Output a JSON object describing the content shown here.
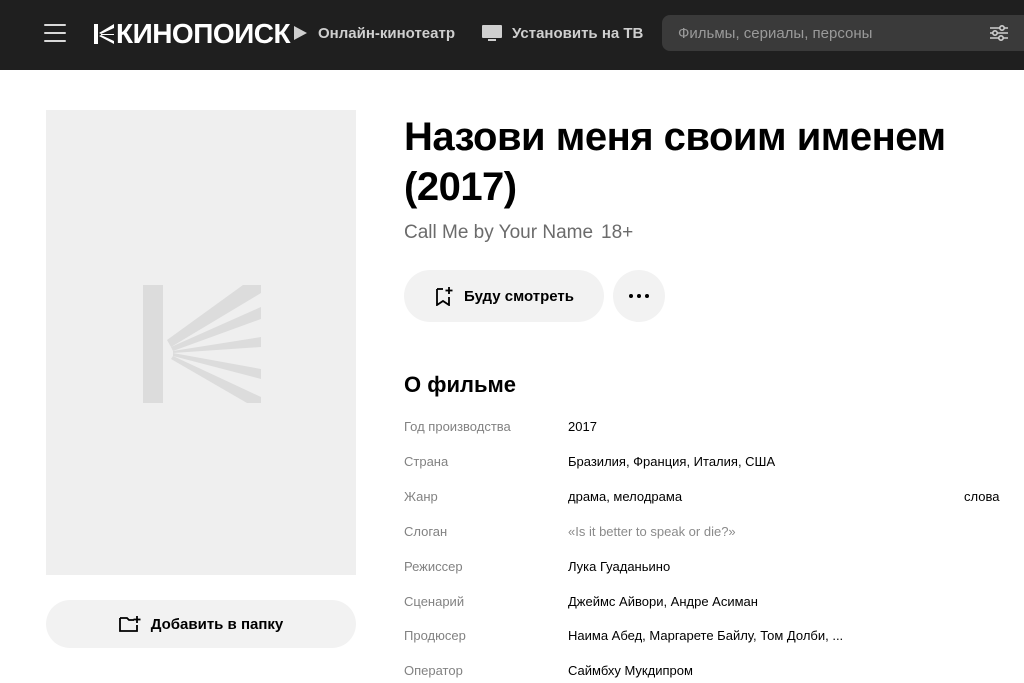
{
  "header": {
    "logo_text": "КИНОПОИСК",
    "nav": [
      {
        "label": "Онлайн-кинотеатр",
        "icon": "play-icon"
      },
      {
        "label": "Установить на ТВ",
        "icon": "tv-icon"
      }
    ],
    "search": {
      "placeholder": "Фильмы, сериалы, персоны"
    }
  },
  "movie": {
    "title": "Назови меня своим именем (2017)",
    "original_title": "Call Me by Your Name",
    "age_rating": "18+",
    "watch_button": "Буду смотреть",
    "folder_button": "Добавить в папку"
  },
  "about": {
    "heading": "О фильме",
    "rows": [
      {
        "label": "Год производства",
        "value": "2017"
      },
      {
        "label": "Страна",
        "value": "Бразилия, Франция, Италия, США"
      },
      {
        "label": "Жанр",
        "value": "драма, мелодрама",
        "extra": "слова"
      },
      {
        "label": "Слоган",
        "value": "«Is it better to speak or die?»"
      },
      {
        "label": "Режиссер",
        "value": "Лука Гуаданьино"
      },
      {
        "label": "Сценарий",
        "value": "Джеймс Айвори, Андре Асиман"
      },
      {
        "label": "Продюсер",
        "value": "Наима Абед, Маргарете Байлу, Том Долби, ..."
      },
      {
        "label": "Оператор",
        "value": "Саймбху Мукдипром"
      }
    ]
  },
  "colors": {
    "header_bg": "#1f1f1f",
    "button_bg": "#f2f2f2",
    "poster_bg": "#efefef"
  }
}
